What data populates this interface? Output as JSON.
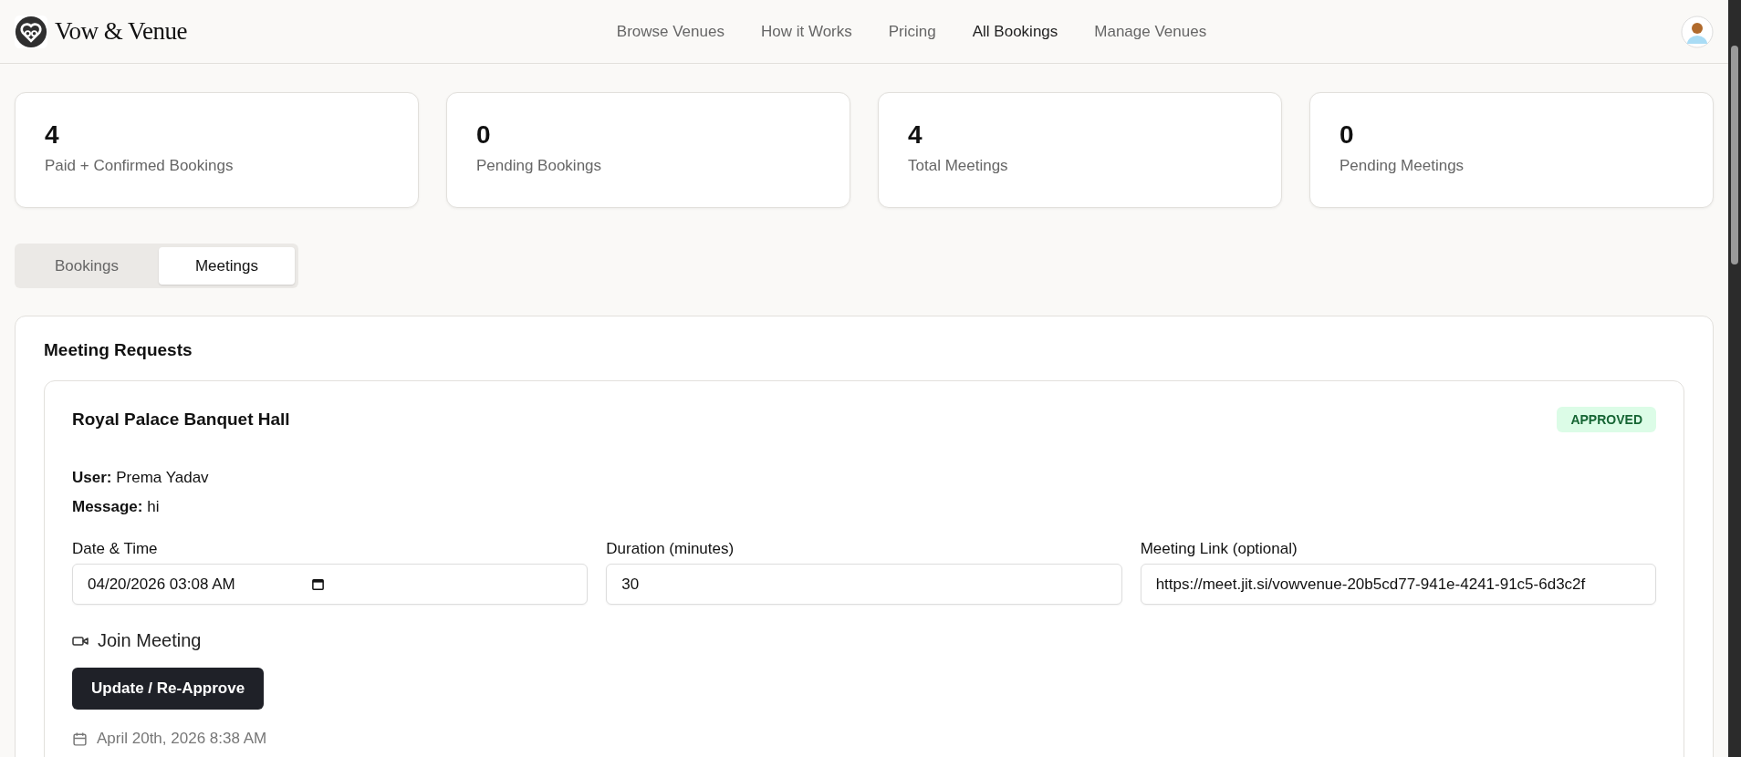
{
  "brand": {
    "name": "Vow & Venue"
  },
  "nav": [
    {
      "label": "Browse Venues",
      "selected": false
    },
    {
      "label": "How it Works",
      "selected": false
    },
    {
      "label": "Pricing",
      "selected": false
    },
    {
      "label": "All Bookings",
      "selected": true
    },
    {
      "label": "Manage Venues",
      "selected": false
    }
  ],
  "stats": [
    {
      "value": "4",
      "label": "Paid + Confirmed Bookings"
    },
    {
      "value": "0",
      "label": "Pending Bookings"
    },
    {
      "value": "4",
      "label": "Total Meetings"
    },
    {
      "value": "0",
      "label": "Pending Meetings"
    }
  ],
  "tabs": [
    {
      "label": "Bookings",
      "selected": false
    },
    {
      "label": "Meetings",
      "selected": true
    }
  ],
  "panel": {
    "title": "Meeting Requests",
    "meetings": [
      {
        "venue": "Royal Palace Banquet Hall",
        "status": {
          "label": "APPROVED",
          "kind": "approved"
        },
        "user_label": "User:",
        "user": "Prema Yadav",
        "message_label": "Message:",
        "message": "hi",
        "fields": [
          {
            "label": "Date & Time",
            "value": "04/20/2026 03:08 AM",
            "kind": "datetime"
          },
          {
            "label": "Duration (minutes)",
            "value": "30",
            "kind": "text"
          },
          {
            "label": "Meeting Link (optional)",
            "value": "https://meet.jit.si/vowvenue-20b5cd77-941e-4241-91c5-6d3c2f",
            "kind": "text"
          }
        ],
        "join_link": "Join Meeting",
        "action": "Update / Re-Approve",
        "created": "April 20th, 2026 8:38 AM"
      }
    ]
  }
}
